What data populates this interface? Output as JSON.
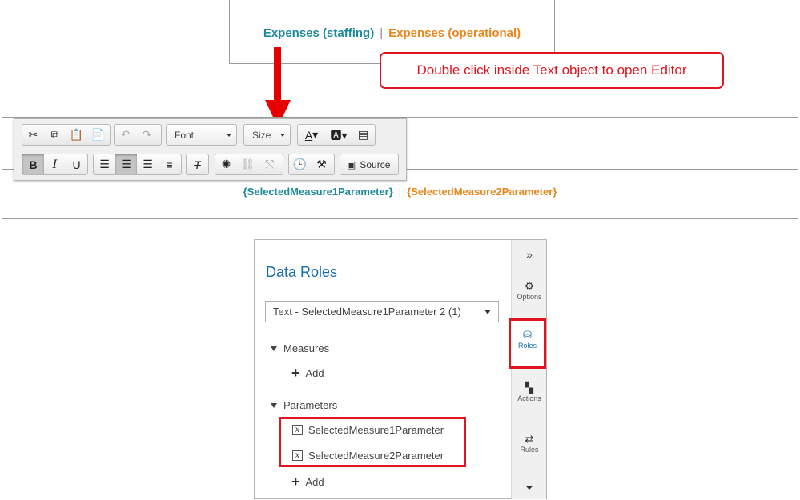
{
  "preview": {
    "left_text": "Expenses (staffing)",
    "separator": "|",
    "right_text": "Expenses (operational)"
  },
  "callout": {
    "text": "Double click inside Text object to open Editor"
  },
  "toolbar": {
    "font_label": "Font",
    "size_label": "Size",
    "source_label": "Source"
  },
  "editor": {
    "left_param": "{SelectedMeasure1Parameter}",
    "separator": "|",
    "right_param": "{SelectedMeasure2Parameter}"
  },
  "data_roles": {
    "title": "Data Roles",
    "selected_object": "Text - SelectedMeasure1Parameter 2 (1)",
    "measures_label": "Measures",
    "add_label": "Add",
    "parameters_label": "Parameters",
    "parameters": [
      "SelectedMeasure1Parameter",
      "SelectedMeasure2Parameter"
    ],
    "add_label_2": "Add"
  },
  "sidebar": {
    "collapse_glyph": "»",
    "items": [
      "Options",
      "Roles",
      "Actions",
      "Rules"
    ]
  },
  "colors": {
    "teal": "#1e8a9c",
    "orange": "#e8861c",
    "highlight_red": "#e0141c",
    "title_blue": "#1a6fa8"
  }
}
